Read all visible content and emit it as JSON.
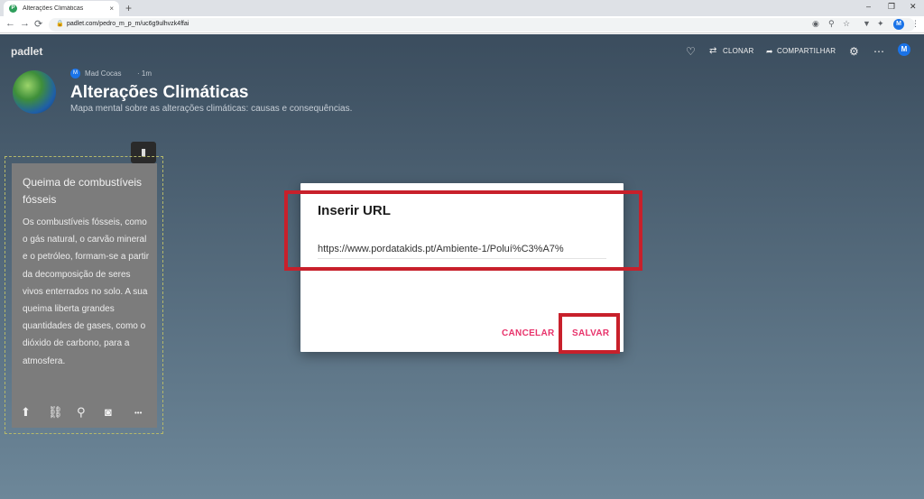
{
  "browser": {
    "tab_title": "Alterações Climáticas",
    "tab_favicon": "P",
    "tab_close": "×",
    "new_tab": "+",
    "url": "padlet.com/pedro_m_p_m/uc6g9ulhvzk4ffai",
    "profile_initial": "M",
    "icons": [
      "back-icon",
      "forward-icon",
      "reload-icon",
      "lock-icon",
      "google-lens-icon",
      "zoom-icon",
      "star-icon",
      "extension-filter-icon",
      "puzzle-icon",
      "menu-dots-icon"
    ],
    "glyphs": {
      "back": "←",
      "forward": "→",
      "reload": "⟳",
      "lock": "🔒",
      "lens": "◉",
      "zoom": "⚲",
      "star": "☆",
      "filter": "▼",
      "puzzle": "✦",
      "dots": "⋮",
      "minimize": "–",
      "restore": "❐",
      "close": "✕"
    }
  },
  "header": {
    "logo": "padlet",
    "clone_label": "CLONAR",
    "share_label": "COMPARTILHAR",
    "heart_icon": "♡",
    "clone_icon": "⇄",
    "share_icon": "➦",
    "gear_icon": "⚙",
    "more_icon": "⋯",
    "avatar_initial": "M"
  },
  "board": {
    "author_initial": "M",
    "author": "Mad Cocas",
    "time": "· 1m",
    "title": "Alterações Climáticas",
    "description": "Mapa mental sobre as alterações climáticas: causas e consequências."
  },
  "card": {
    "title": "Queima de combustíveis fósseis",
    "body": "Os combustíveis fósseis, como o gás natural, o carvão mineral e o petróleo, formam-se a partir da decomposição de seres vivos enterrados no solo. A sua queima liberta grandes quantidades de gases, como o dióxido de carbono, para a atmosfera.",
    "trash_icon": "▮",
    "tools": {
      "upload": "⬆",
      "link": "⛓",
      "search": "⚲",
      "camera": "◙",
      "more": "•••"
    }
  },
  "dialog": {
    "title": "Inserir URL",
    "url_value": "https://www.pordatakids.pt/Ambiente-1/Poluí%C3%A7%",
    "cancel_label": "CANCELAR",
    "save_label": "SALVAR"
  },
  "colors": {
    "accent": "#e8336b",
    "highlight": "#c8202b",
    "page_top": "#3b4d5e",
    "page_bottom": "#6d8799"
  }
}
